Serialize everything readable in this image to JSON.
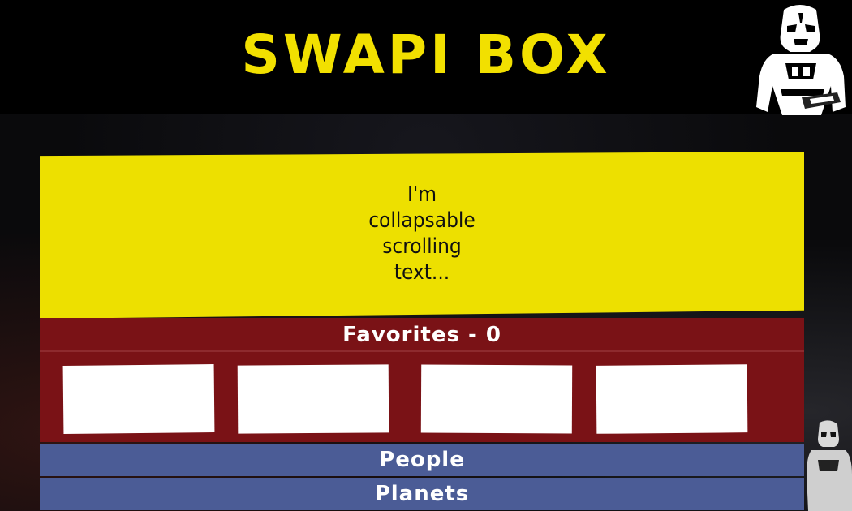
{
  "header": {
    "title": "SWAPI BOX",
    "logo_icon": "stormtrooper-icon"
  },
  "crawl": {
    "lines": [
      "I'm",
      "collapsable",
      "scrolling",
      "text..."
    ]
  },
  "favorites": {
    "header_label": "Favorites - 0",
    "cards": [
      {},
      {},
      {},
      {}
    ]
  },
  "tabs": [
    {
      "label": "People"
    },
    {
      "label": "Planets"
    }
  ],
  "colors": {
    "title_yellow": "#f2e000",
    "crawl_yellow": "#ede000",
    "favorites_red": "#7a1216",
    "tab_blue": "#4b5c96"
  }
}
